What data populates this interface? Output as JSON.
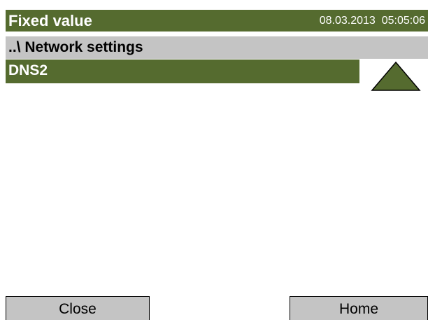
{
  "header": {
    "title": "Fixed value",
    "datetime": "08.03.2013  05:05:06"
  },
  "breadcrumb": {
    "text": "..\\ Network settings"
  },
  "list": {
    "items": [
      {
        "label": "DNS2",
        "selected": true
      }
    ]
  },
  "scroll": {
    "up_icon": "triangle-up-icon"
  },
  "footer": {
    "close_label": "Close",
    "home_label": "Home"
  },
  "colors": {
    "accent": "#556b2f",
    "bar_gray": "#c4c4c4",
    "text_light": "#ffffff",
    "text_dark": "#000000"
  }
}
